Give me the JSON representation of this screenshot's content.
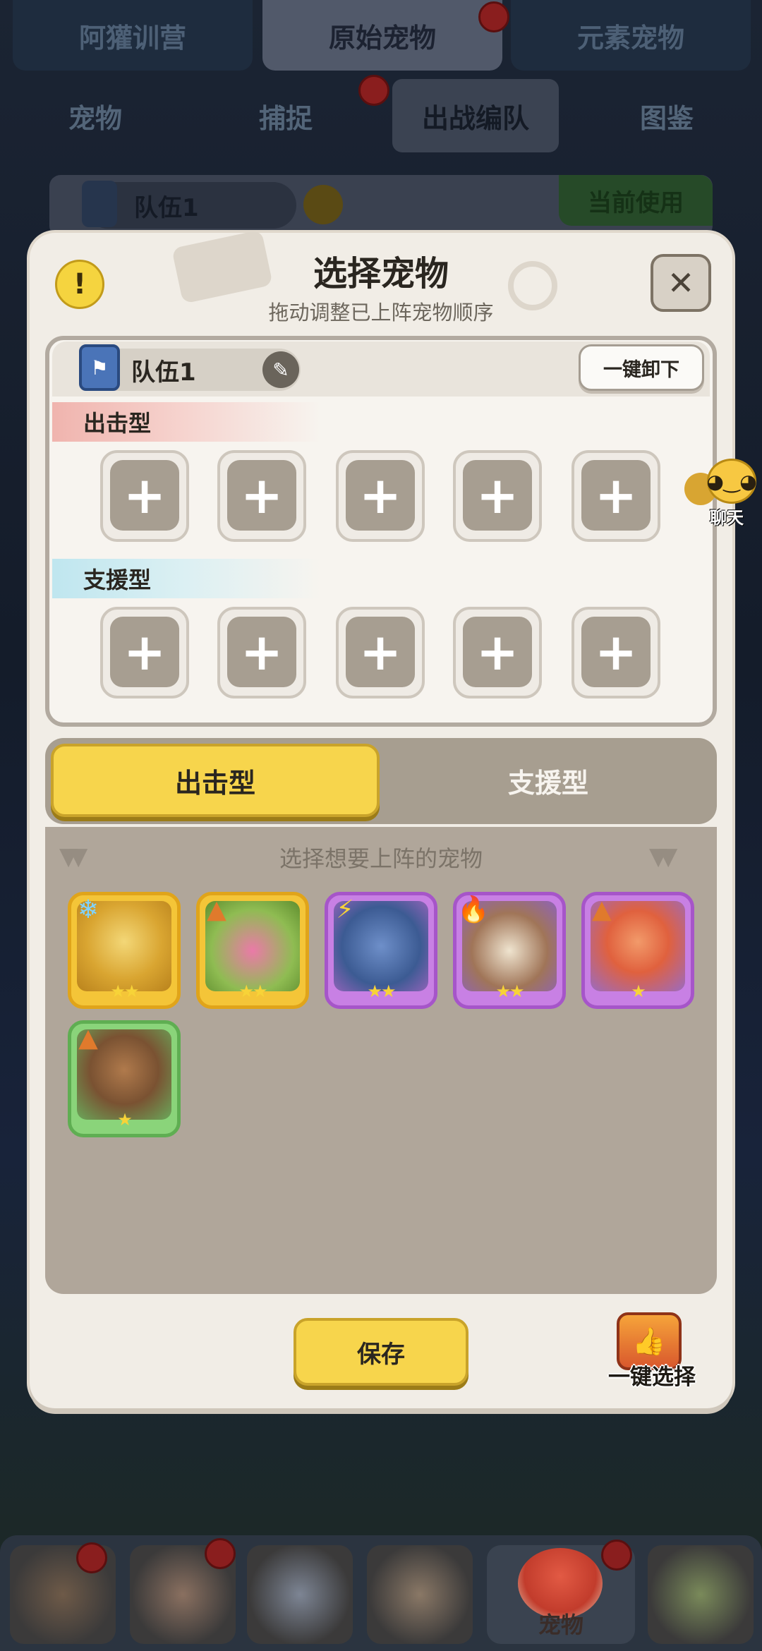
{
  "top_tabs": [
    "阿獾训营",
    "原始宠物",
    "元素宠物"
  ],
  "sub_tabs": [
    "宠物",
    "捕捉",
    "出战编队",
    "图鉴"
  ],
  "bg_team": {
    "name": "队伍1",
    "status": "当前使用"
  },
  "modal": {
    "title": "选择宠物",
    "subtitle": "拖动调整已上阵宠物顺序",
    "info_symbol": "!",
    "close_symbol": "✕"
  },
  "team": {
    "name": "队伍1",
    "flag_symbol": "⚑",
    "edit_symbol": "✎",
    "unload_label": "一键卸下"
  },
  "categories": {
    "attack": "出击型",
    "support": "支援型"
  },
  "slot_symbol": "+",
  "type_tabs": {
    "active": "出击型",
    "inactive": "支援型"
  },
  "pick_hint": "选择想要上阵的宠物",
  "pets": [
    {
      "stars": "★★",
      "element_icon": "snowflake-icon",
      "element_symbol": "❄",
      "rarity": "gold"
    },
    {
      "stars": "★★",
      "element_icon": "earth-triangle-icon",
      "element_symbol": "▲",
      "rarity": "gold"
    },
    {
      "stars": "★★",
      "element_icon": "lightning-icon",
      "element_symbol": "⚡",
      "rarity": "purple"
    },
    {
      "stars": "★★",
      "element_icon": "fire-icon",
      "element_symbol": "🔥",
      "rarity": "purple"
    },
    {
      "stars": "★",
      "element_icon": "earth-triangle-icon",
      "element_symbol": "▲",
      "rarity": "purple"
    },
    {
      "stars": "★",
      "element_icon": "earth-triangle-icon",
      "element_symbol": "▲",
      "rarity": "green"
    }
  ],
  "save_label": "保存",
  "auto_select_label": "一键选择",
  "chat_label": "聊天",
  "bottom_nav": {
    "active_label": "宠物"
  },
  "colors": {
    "accent_yellow": "#f7d54c",
    "gold": "#f4c538",
    "purple": "#c880e4",
    "green": "#8ad47a"
  }
}
